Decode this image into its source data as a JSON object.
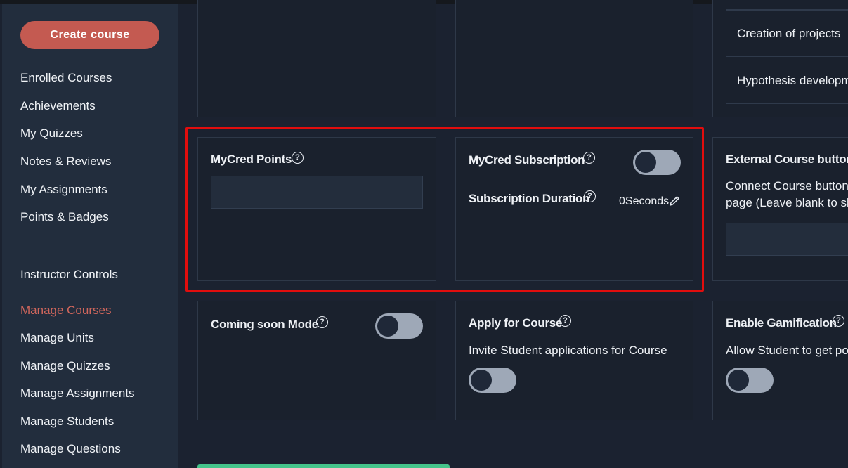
{
  "sidebar": {
    "create_button": "Create course",
    "items": [
      {
        "label": "Enrolled Courses"
      },
      {
        "label": "Achievements"
      },
      {
        "label": "My Quizzes"
      },
      {
        "label": "Notes & Reviews"
      },
      {
        "label": "My Assignments"
      },
      {
        "label": "Points & Badges"
      }
    ],
    "instructor_heading": "Instructor Controls",
    "instructor_items": [
      {
        "label": "Manage Courses",
        "active": true
      },
      {
        "label": "Manage Units"
      },
      {
        "label": "Manage Quizzes"
      },
      {
        "label": "Manage Assignments"
      },
      {
        "label": "Manage Students"
      },
      {
        "label": "Manage Questions"
      }
    ]
  },
  "list": {
    "items": [
      "Creation of projects",
      "Hypothesis developme"
    ]
  },
  "cards": {
    "mycred_points": {
      "title": "MyCred Points",
      "value": ""
    },
    "mycred_subscription": {
      "title": "MyCred Subscription",
      "enabled": false,
      "duration_label": "Subscription Duration",
      "duration_value": "0Seconds"
    },
    "external_button": {
      "title": "External Course button li",
      "desc_line1": "Connect Course button to",
      "desc_line2": "page (Leave blank to skip",
      "value": ""
    },
    "coming_soon": {
      "title": "Coming soon Mode",
      "enabled": false
    },
    "apply_course": {
      "title": "Apply for Course",
      "desc": "Invite Student applications for Course",
      "enabled": false
    },
    "gamification": {
      "title": "Enable Gamification",
      "desc": "Allow Student to get poin",
      "enabled": false
    }
  },
  "colors": {
    "accent": "#c45a51",
    "highlight": "#e10d0d",
    "toggle_off": "#9ea8b7",
    "success": "#44c48a"
  },
  "icons": [
    "help-circle-icon",
    "pencil-icon"
  ]
}
